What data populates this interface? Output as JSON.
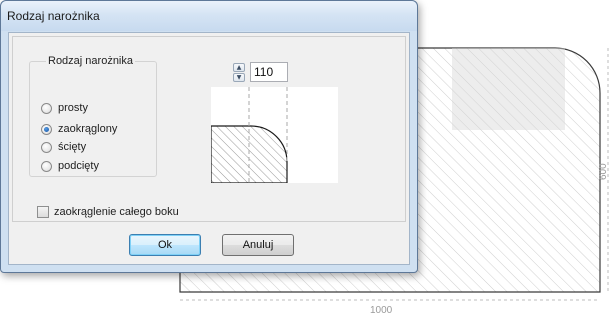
{
  "window": {
    "title": "Rodzaj narożnika"
  },
  "corner_group": {
    "label": "Rodzaj narożnika",
    "options": [
      {
        "label": "prosty",
        "checked": false
      },
      {
        "label": "zaokrąglony",
        "checked": true
      },
      {
        "label": "ścięty",
        "checked": false
      },
      {
        "label": "podcięty",
        "checked": false
      }
    ]
  },
  "radius": {
    "value": "110"
  },
  "round_whole_side": {
    "label": "zaokrąglenie całego boku",
    "checked": false
  },
  "buttons": {
    "ok": "Ok",
    "cancel": "Anuluj"
  },
  "drawing": {
    "width_label": "1000",
    "height_label": "600"
  }
}
